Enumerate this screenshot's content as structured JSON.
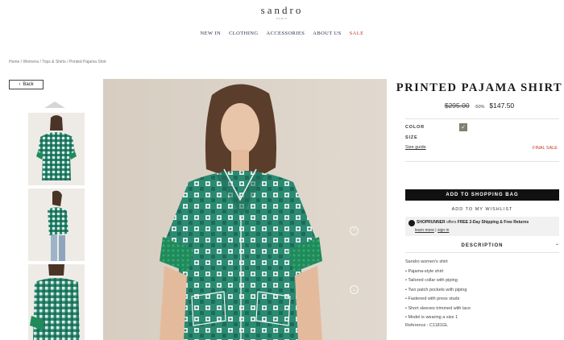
{
  "brand": {
    "name": "sandro",
    "sub": "PARIS"
  },
  "nav": {
    "items": [
      "NEW IN",
      "CLOTHING",
      "ACCESSORIES",
      "ABOUT US",
      "SALE"
    ]
  },
  "breadcrumb": "Home / Womens / Tops & Shirts / Printed Pajama Shirt",
  "back": {
    "label": "Back",
    "icon": "chevron-left-icon"
  },
  "product": {
    "title": "PRINTED PAJAMA SHIRT",
    "old_price": "$295.00",
    "discount": "-50%",
    "new_price": "$147.50",
    "color_label": "COLOR",
    "size_label": "SIZE",
    "size_guide": "Size guide",
    "final_sale": "FINAL SALE",
    "add_to_bag": "ADD TO SHOPPING BAG",
    "wishlist": "ADD TO MY WISHLIST",
    "swatch_color": "#7d816e"
  },
  "shoprunner": {
    "logo": "SHOPRUNNER",
    "offers": " offers ",
    "offer_text": "FREE 2-Day Shipping & Free Returns",
    "learn_more": "learn more",
    "separator": " | ",
    "sign_in": "sign in"
  },
  "description": {
    "heading": "DESCRIPTION",
    "lines": [
      "Sandro women's shirt",
      "• Pajama-style shirt",
      "• Tailored collar with piping",
      "• Two patch pockets with piping",
      "• Fastened with press studs",
      "• Short sleeves trimmed with lace",
      "• Model is wearing a size 1"
    ],
    "reference": "Reference : C1181GL"
  },
  "colors": {
    "shirt": "#2a8a72",
    "shirt_dark": "#1d6b57",
    "lace": "#20885e",
    "accent_sale": "#c0392b"
  }
}
